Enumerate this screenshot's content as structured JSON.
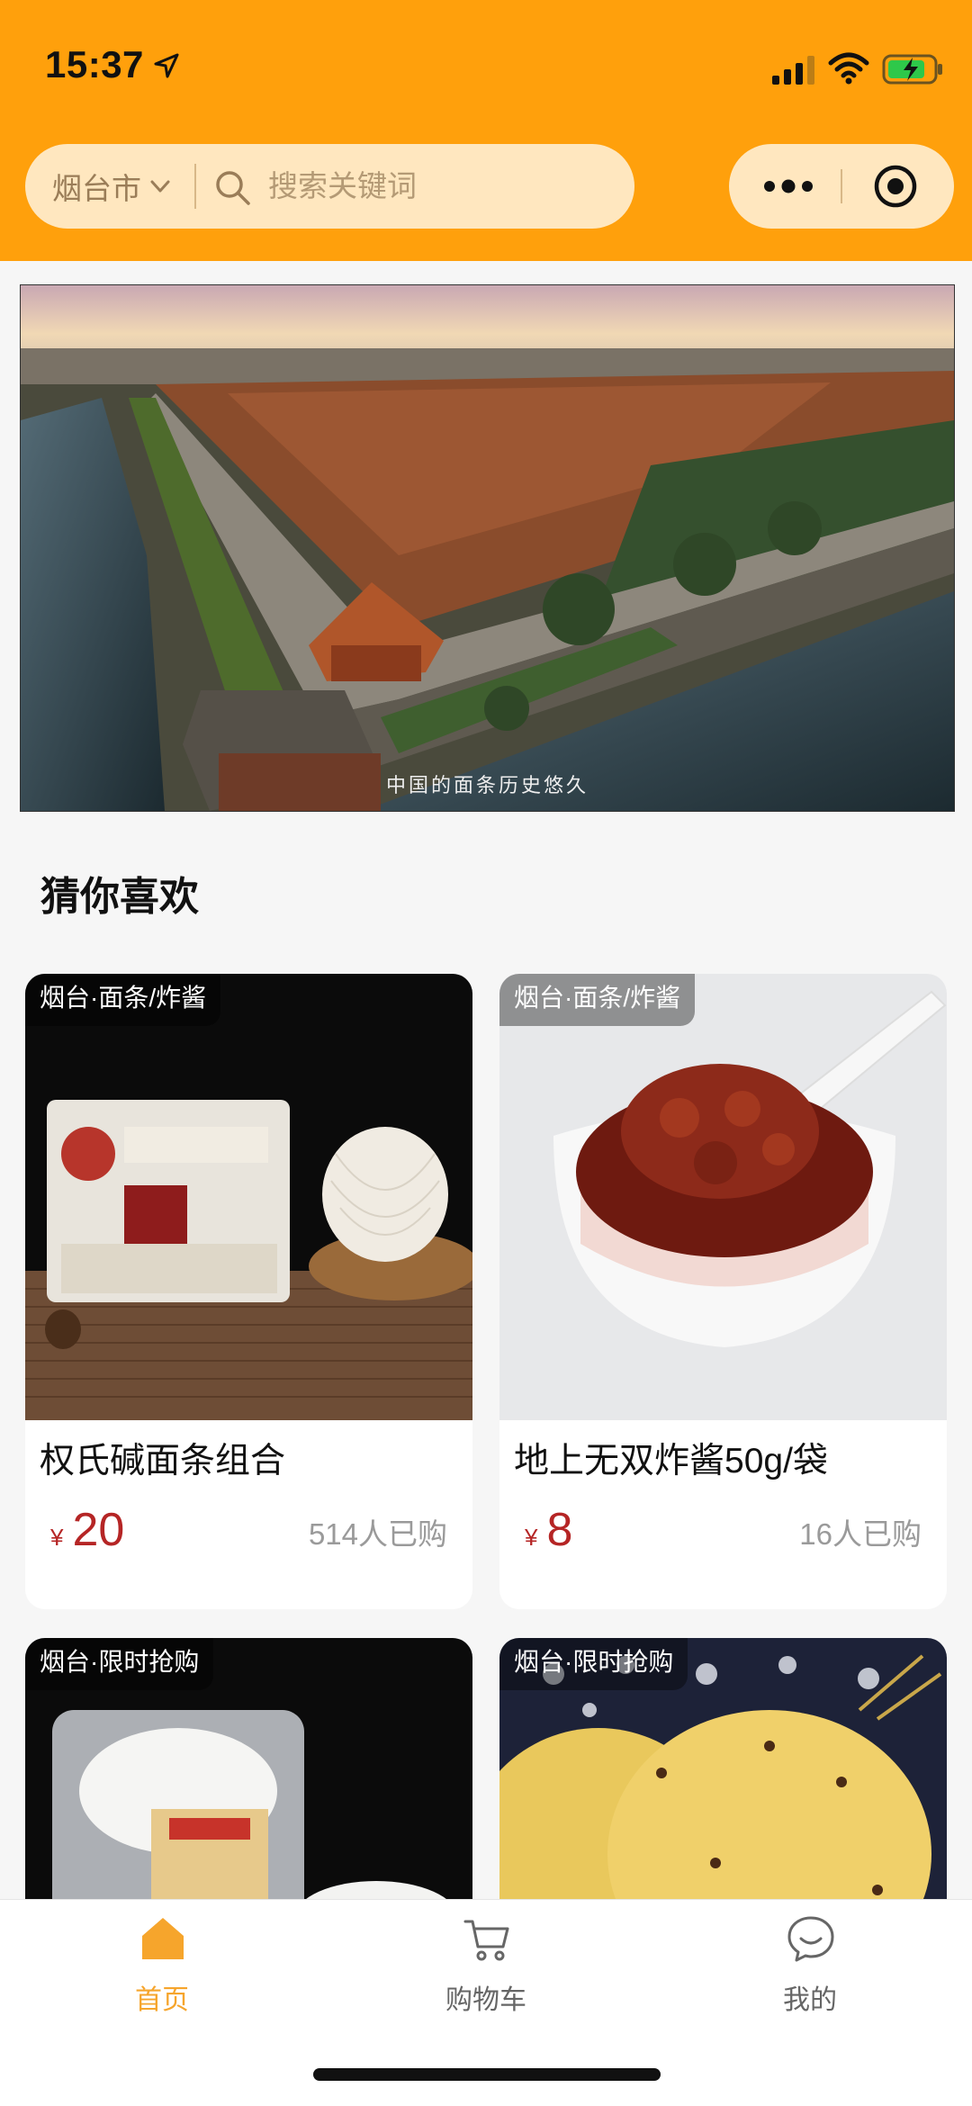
{
  "status_bar": {
    "time": "15:37"
  },
  "header": {
    "city": "烟台市",
    "search_placeholder": "搜索关键词"
  },
  "banner": {
    "caption": "中国的面条历史悠久"
  },
  "section": {
    "title": "猜你喜欢"
  },
  "products": [
    {
      "tag": "烟台·面条/炸酱",
      "name": "权氏碱面条组合",
      "currency": "¥",
      "price": "20",
      "sold": "514人已购"
    },
    {
      "tag": "烟台·面条/炸酱",
      "name": "地上无双炸酱50g/袋",
      "currency": "¥",
      "price": "8",
      "sold": "16人已购"
    },
    {
      "tag": "烟台·限时抢购",
      "name": "",
      "currency": "",
      "price": "",
      "sold": ""
    },
    {
      "tag": "烟台·限时抢购",
      "name": "",
      "currency": "",
      "price": "",
      "sold": ""
    }
  ],
  "tabbar": {
    "items": [
      {
        "label": "首页",
        "icon": "home-icon",
        "active": true
      },
      {
        "label": "购物车",
        "icon": "cart-icon",
        "active": false
      },
      {
        "label": "我的",
        "icon": "chat-bubble-icon",
        "active": false
      }
    ]
  },
  "colors": {
    "header_bg": "#FFA00C",
    "capsule_bg": "#FFE7BF",
    "price": "#B52525",
    "tab_active": "#F6A52C"
  }
}
